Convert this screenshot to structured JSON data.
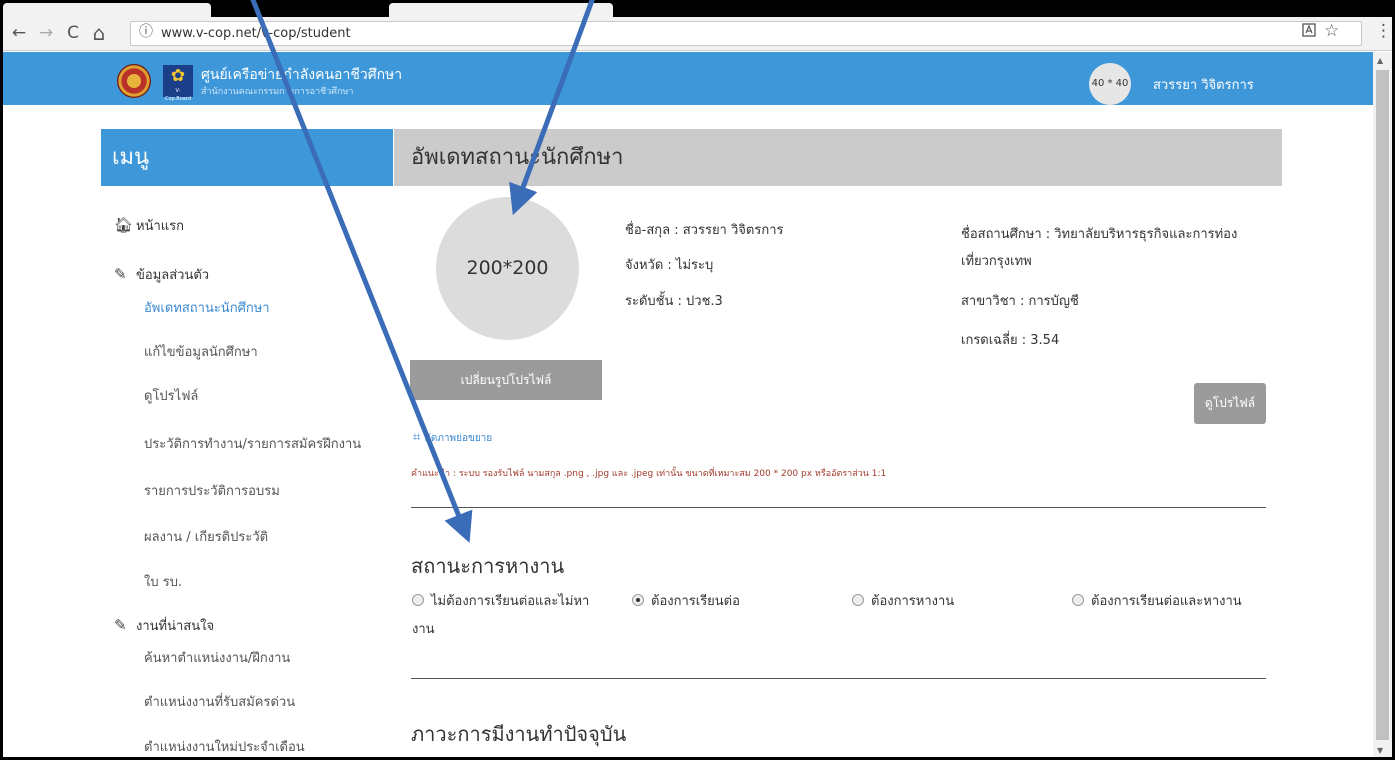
{
  "browser": {
    "back_icon": "←",
    "forward_icon": "→",
    "reload_icon": "C",
    "home_icon": "⌂",
    "info_icon": "ⓘ",
    "url": "www.v-cop.net/v-cop/student",
    "toolbar_icons": [
      "translate-icon",
      "star-icon",
      "menu-icon"
    ]
  },
  "site": {
    "title": "ศูนย์เครือข่ายกำลังคนอาชีวศึกษา",
    "subtitle": "สำนักงานคณะกรรมการการอาชีวศึกษา",
    "logo_text": "V-Cop.Board",
    "avatar_label": "40 * 40",
    "user_name": "สวรรยา วิจิตรการ"
  },
  "sidebar": {
    "heading": "เมนู",
    "home": "หน้าแรก",
    "personal": "ข้อมูลส่วนตัว",
    "personal_items": [
      "อัพเดทสถานะนักศึกษา",
      "แก้ไขข้อมูลนักศึกษา",
      "ดูโปรไฟล์",
      "ประวัติการทำงาน/รายการสมัครฝึกงาน",
      "รายการประวัติการอบรม",
      "ผลงาน / เกียรติประวัติ",
      "ใบ รบ."
    ],
    "jobs": "งานที่น่าสนใจ",
    "job_items": [
      "ค้นหาตำแหน่งงาน/ฝึกงาน",
      "ตำแหน่งงานที่รับสมัครด่วน",
      "ตำแหน่งงานใหม่ประจำเดือน"
    ]
  },
  "main": {
    "heading": "อัพเดทสถานะนักศึกษา",
    "avatar_label": "200*200",
    "name": "ชื่อ-สกุล : สวรรยา วิจิตรการ",
    "province": "จังหวัด : ไม่ระบุ",
    "level": "ระดับชั้น : ปวช.3",
    "school": "ชื่อสถานศึกษา : วิทยาลัยบริหารธุรกิจและการท่องเที่ยวกรุงเทพ",
    "major": "สาขาวิชา : การบัญชี",
    "gpa": "เกรดเฉลี่ย : 3.54",
    "change_photo_button": "เปลี่ยนรูปโปรไฟล์",
    "view_profile_button": "ดูโปรไฟล์",
    "crop_link": "ตัดภาพย่อขยาย",
    "hint": "คำแนะนำ : ระบบ รองรับไฟล์ นามสกุล .png , .jpg และ .jpeg เท่านั้น ขนาดที่เหมาะสม 200 * 200 px หรืออัตราส่วน 1:1",
    "job_status_title": "สถานะการหางาน",
    "job_status_options": [
      {
        "label": "ไม่ต้องการเรียนต่อและไม่หางาน",
        "selected": false
      },
      {
        "label": "ต้องการเรียนต่อ",
        "selected": true
      },
      {
        "label": "ต้องการหางาน",
        "selected": false
      },
      {
        "label": "ต้องการเรียนต่อและหางาน",
        "selected": false
      }
    ],
    "employment_title": "ภาวะการมีงานทำปัจจุบัน"
  },
  "colors": {
    "accent": "#3d97d9",
    "header_gray": "#cbcbcb",
    "button_gray": "#9b9b9b",
    "hint_red": "#a23b2a",
    "arrow_blue": "#3a6cb8"
  }
}
